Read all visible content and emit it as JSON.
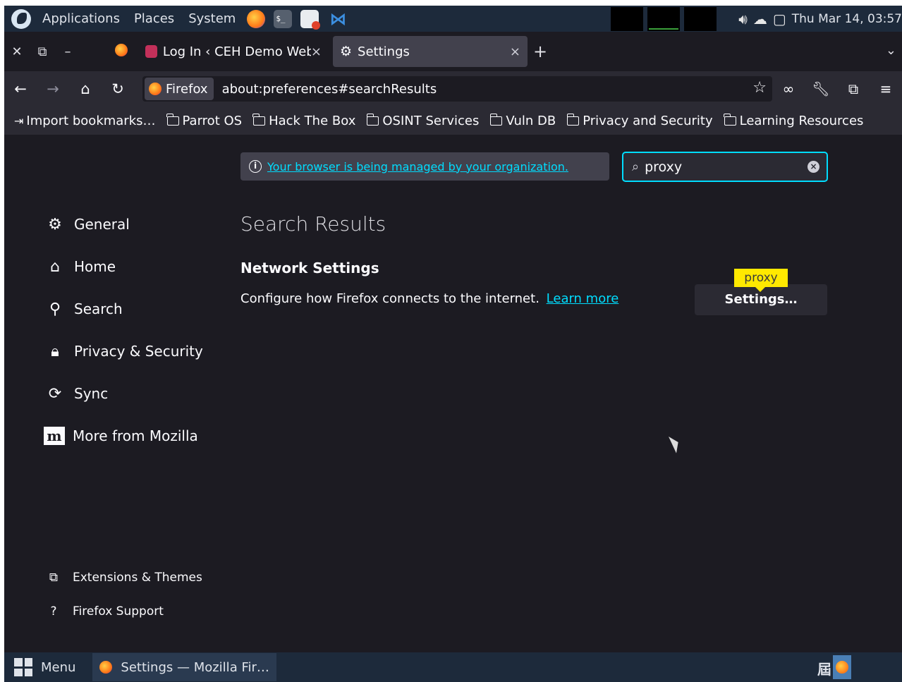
{
  "top_panel": {
    "menus": [
      "Applications",
      "Places",
      "System"
    ],
    "launchers": [
      "firefox-icon",
      "terminal-icon",
      "notes-icon",
      "vscode-icon"
    ],
    "terminal_glyph": "$_",
    "clock": "Thu Mar 14, 03:57"
  },
  "tabs": [
    {
      "label": "Log In ‹ CEH Demo Webs",
      "close": "×"
    },
    {
      "label": "Settings",
      "close": "×"
    }
  ],
  "navbar": {
    "identity_label": "Firefox",
    "url": "about:preferences#searchResults"
  },
  "bookmarks": {
    "import_label": "Import bookmarks…",
    "folders": [
      "Parrot OS",
      "Hack The Box",
      "OSINT Services",
      "Vuln DB",
      "Privacy and Security",
      "Learning Resources"
    ]
  },
  "preferences": {
    "policy_notice": "Your browser is being managed by your organization.",
    "search_value": "proxy",
    "categories": [
      {
        "icon": "gear-icon",
        "label": "General"
      },
      {
        "icon": "home-icon",
        "label": "Home"
      },
      {
        "icon": "search-icon",
        "label": "Search"
      },
      {
        "icon": "lock-icon",
        "label": "Privacy & Security"
      },
      {
        "icon": "sync-icon",
        "label": "Sync"
      },
      {
        "icon": "mozilla-icon",
        "label": "More from Mozilla"
      }
    ],
    "footer": [
      {
        "icon": "puzzle-icon",
        "label": "Extensions & Themes"
      },
      {
        "icon": "help-icon",
        "label": "Firefox Support"
      }
    ],
    "results_title": "Search Results",
    "group_title": "Network Settings",
    "group_desc": "Configure how Firefox connects to the internet.",
    "learn_more": "Learn more",
    "settings_button": "Settings…",
    "highlight_tooltip": "proxy"
  },
  "bottom_panel": {
    "menu_label": "Menu",
    "task_label": "Settings — Mozilla Fir…",
    "workspace_label": "⁠屆"
  },
  "colors": {
    "accent": "#00ddff",
    "highlight": "#ffe900",
    "panel": "#1d2a3b",
    "content_bg": "#1c1b22"
  }
}
